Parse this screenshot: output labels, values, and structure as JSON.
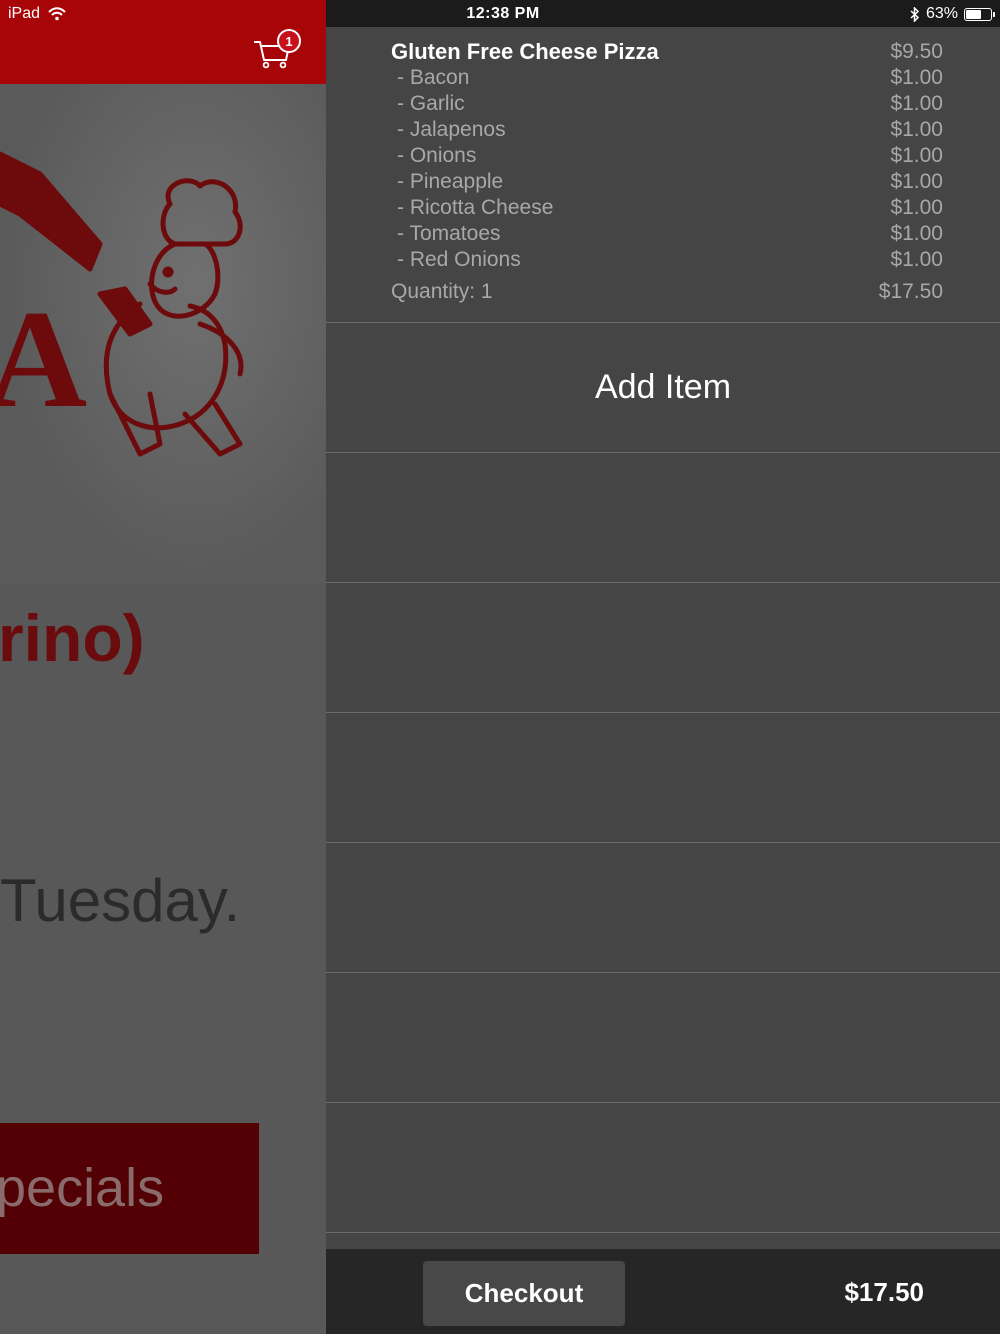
{
  "status_bar": {
    "device": "iPad",
    "time": "12:38 PM",
    "battery": "63%",
    "battery_level": 0.63
  },
  "background": {
    "cart_count": "1",
    "hero_letter": "A",
    "heading_fragment": "rino)",
    "text_fragment": "Tuesday.",
    "button_fragment": "pecials",
    "header_color": "#a80508"
  },
  "cart": {
    "item": {
      "name": "Gluten Free Cheese Pizza",
      "price": "$9.50",
      "modifiers": [
        {
          "label": "- Bacon",
          "price": "$1.00"
        },
        {
          "label": "- Garlic",
          "price": "$1.00"
        },
        {
          "label": "- Jalapenos",
          "price": "$1.00"
        },
        {
          "label": "- Onions",
          "price": "$1.00"
        },
        {
          "label": "- Pineapple",
          "price": "$1.00"
        },
        {
          "label": "- Ricotta Cheese",
          "price": "$1.00"
        },
        {
          "label": "- Tomatoes",
          "price": "$1.00"
        },
        {
          "label": "- Red Onions",
          "price": "$1.00"
        }
      ],
      "quantity_label": "Quantity: 1",
      "line_total": "$17.50"
    },
    "add_item_label": "Add Item",
    "checkout_label": "Checkout",
    "total": "$17.50"
  }
}
